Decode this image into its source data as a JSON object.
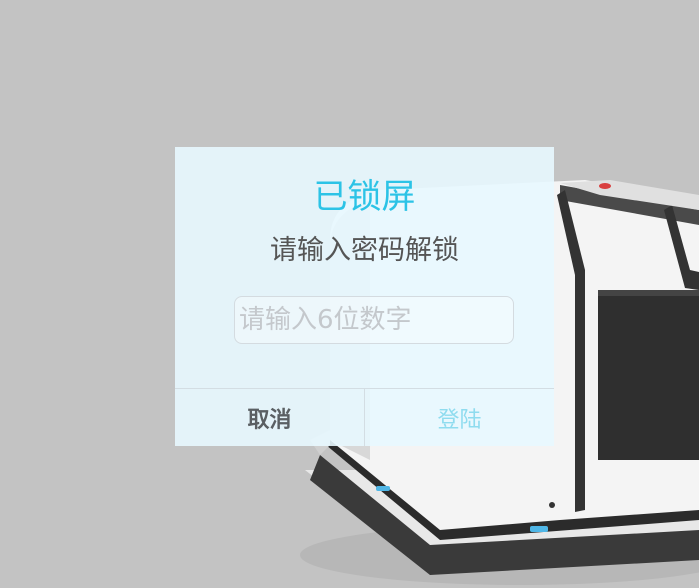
{
  "dialog": {
    "title": "已锁屏",
    "subtitle": "请输入密码解锁",
    "input": {
      "value": "",
      "placeholder": "请输入6位数字"
    },
    "cancel_label": "取消",
    "login_label": "登陆"
  },
  "colors": {
    "accent": "#2cc3e6",
    "login_text": "#8fdcef",
    "backdrop": "#c3c3c3"
  }
}
